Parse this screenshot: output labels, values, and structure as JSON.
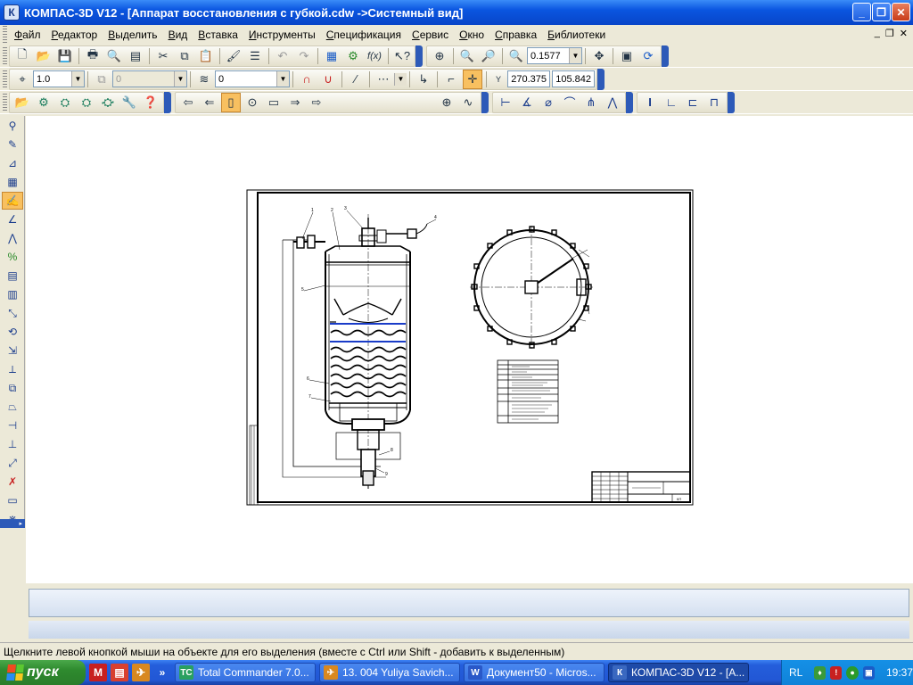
{
  "window": {
    "title": "КОМПАС-3D V12 - [Аппарат восстановления с губкой.cdw ->Системный вид]",
    "app_icon": "К",
    "buttons": {
      "minimize": "_",
      "maximize": "❐",
      "close": "✕"
    }
  },
  "menu": [
    {
      "label": "Файл"
    },
    {
      "label": "Редактор"
    },
    {
      "label": "Выделить"
    },
    {
      "label": "Вид"
    },
    {
      "label": "Вставка"
    },
    {
      "label": "Инструменты"
    },
    {
      "label": "Спецификация"
    },
    {
      "label": "Сервис"
    },
    {
      "label": "Окно"
    },
    {
      "label": "Справка"
    },
    {
      "label": "Библиотеки"
    }
  ],
  "doc_controls": {
    "minimize": "_",
    "restore": "❐",
    "close": "✕"
  },
  "toolbar_standard": {
    "zoom_value": "0.1577"
  },
  "toolbar_current_state": {
    "step_value": "1.0",
    "layer_value": "0",
    "style_value": "0",
    "x_coord": "270.375",
    "y_coord": "105.842",
    "coord_label": "Y"
  },
  "drawing": {
    "balloons": [
      "1",
      "2",
      "3",
      "4",
      "5",
      "6",
      "7",
      "8",
      "9"
    ],
    "title_block_label": "КП"
  },
  "statusbar": {
    "text": "Щелкните левой кнопкой мыши на объекте для его выделения (вместе с Ctrl или Shift - добавить к выделенным)"
  },
  "taskbar": {
    "start_label": "пуск",
    "more": "»",
    "tasks": [
      {
        "label": "Total Commander 7.0...",
        "icon": "TC",
        "color": "#2aa060"
      },
      {
        "label": "13. 004 Yuliya Savich...",
        "icon": "✈",
        "color": "#d88820"
      },
      {
        "label": "Документ50 - Micros...",
        "icon": "W",
        "color": "#2a58c8"
      },
      {
        "label": "КОМПАС-3D V12 - [А...",
        "icon": "К",
        "color": "#3a68c0",
        "active": true
      }
    ],
    "lang": "RL",
    "clock": "19:37"
  },
  "colors": {
    "titlebar": "#0a55e0",
    "taskbar": "#245edb",
    "start": "#2e8a2e",
    "selected_tool": "#f8c060",
    "liquid_line": "#1a3cc8"
  }
}
